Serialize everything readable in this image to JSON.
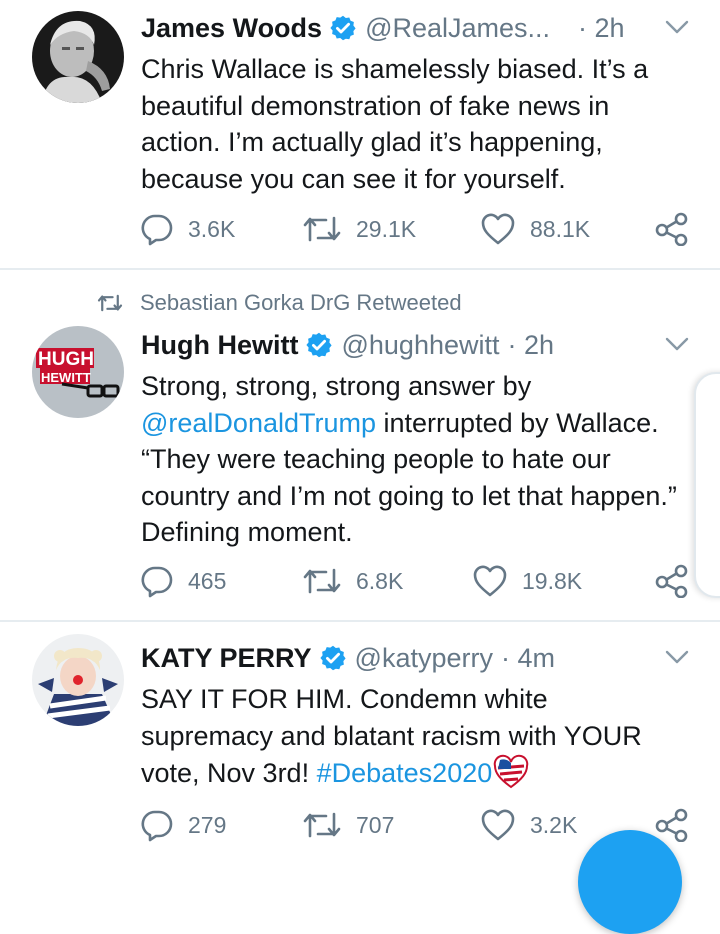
{
  "tweets": [
    {
      "name": "James Woods",
      "handle": "@RealJames...",
      "time": "· 2h",
      "text": "Chris Wallace is shamelessly biased. It’s a beautiful demonstration of fake news in action. I’m actually glad it’s happening, because you can see it for yourself.",
      "replies": "3.6K",
      "retweets": "29.1K",
      "likes": "88.1K"
    },
    {
      "retweeted_by": "Sebastian Gorka DrG Retweeted",
      "name": "Hugh Hewitt",
      "handle": "@hughhewitt",
      "time": "· 2h",
      "avatar_text_1": "HUGH",
      "avatar_text_2": "HEWITT",
      "mention": "@realDonaldTrump",
      "text_before": "Strong, strong, strong answer by",
      "text_after": "interrupted by Wallace. “They were teaching people to hate our country and I’m not going to let that happen.” Defining moment.",
      "replies": "465",
      "retweets": "6.8K",
      "likes": "19.8K"
    },
    {
      "name": "KATY PERRY",
      "handle": "@katyperry",
      "time": "· 4m",
      "text_before": "SAY IT FOR HIM. Condemn white supremacy and blatant racism with YOUR vote, Nov 3rd!",
      "hashtag": "#Debates2020",
      "replies": "279",
      "retweets": "707",
      "likes": "3.2K"
    }
  ],
  "colors": {
    "verified": "#1da1f2",
    "link": "#1b95e0",
    "muted": "#657786",
    "fab": "#1da1f2"
  },
  "icons": [
    "verified-icon",
    "chevron-down-icon",
    "reply-icon",
    "retweet-icon",
    "like-icon",
    "share-icon",
    "debate-flag-heart-icon"
  ]
}
